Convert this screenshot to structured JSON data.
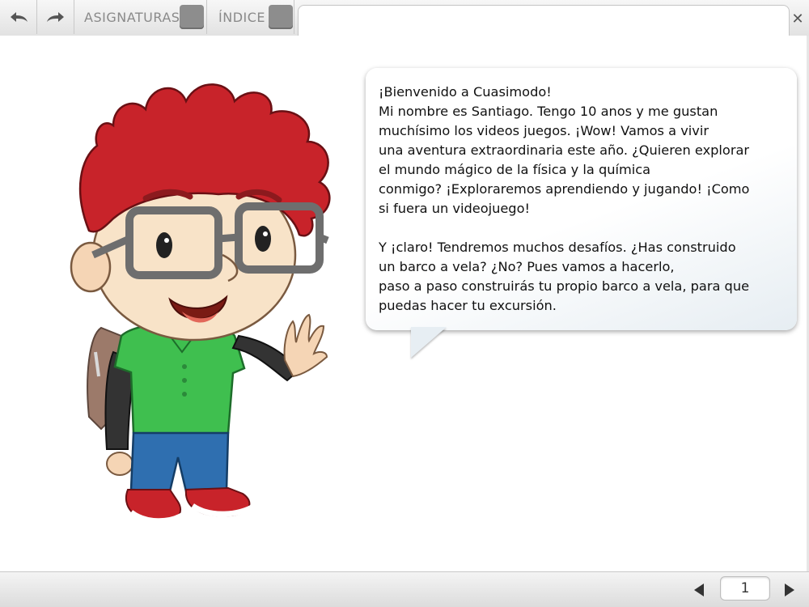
{
  "toolbar": {
    "undo_icon": "undo-arrow-icon",
    "redo_icon": "redo-arrow-icon",
    "tab_subjects": "ASIGNATURAS",
    "tab_index": "ÍNDICE",
    "close_label": "✕"
  },
  "speech": {
    "lines": [
      "¡Bienvenido a Cuasimodo!",
      "Mi nombre es Santiago. Tengo 10 anos y me gustan",
      "muchísimo los videos juegos. ¡Wow! Vamos a vivir",
      "una aventura extraordinaria este año. ¿Quieren explorar",
      "el mundo mágico de la física y la química",
      "conmigo? ¡Exploraremos aprendiendo y jugando! ¡Como",
      "si fuera un videojuego!"
    ],
    "lines2": [
      "Y ¡claro! Tendremos muchos desafíos. ¿Has construido",
      "un barco a vela? ¿No? Pues vamos a hacerlo,",
      "paso a paso construirás tu propio barco a vela, para que",
      "puedas hacer tu excursión."
    ]
  },
  "pager": {
    "page": "1"
  },
  "colors": {
    "hair": "#c8232a",
    "shirt": "#3fbf4f",
    "pants": "#2f6fb0"
  }
}
